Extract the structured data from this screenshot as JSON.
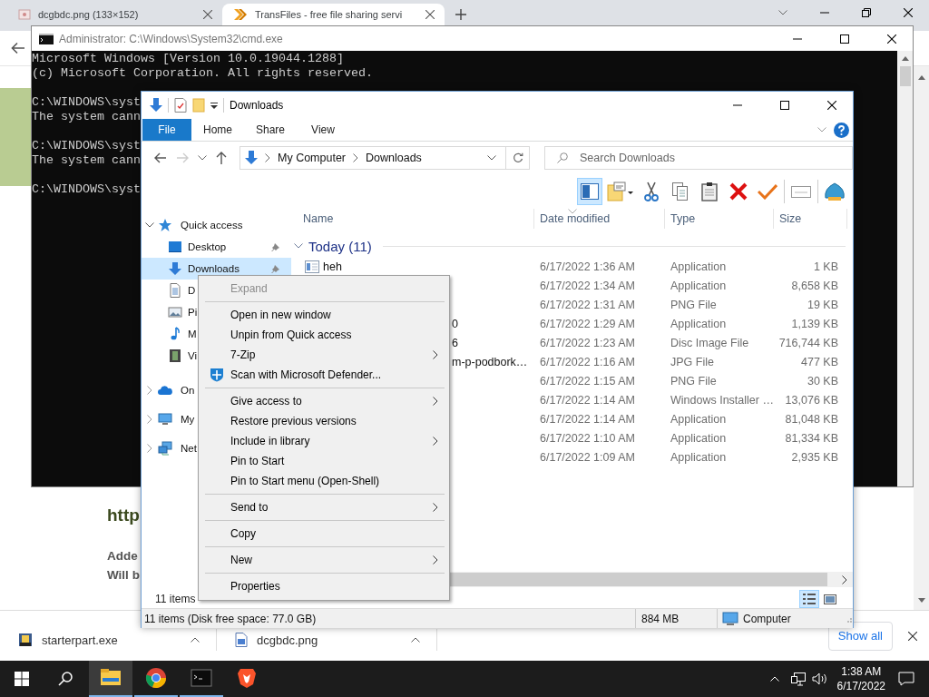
{
  "browser": {
    "tabs": [
      {
        "title": "dcgbdc.png (133×152)",
        "selected": false
      },
      {
        "title": "TransFiles - free file sharing servi",
        "selected": true
      }
    ],
    "page": {
      "heading": "http",
      "lines": [
        "Adde",
        "Will b"
      ]
    }
  },
  "cmd_window": {
    "title": "Administrator: C:\\Windows\\System32\\cmd.exe",
    "blocks": [
      [
        "Microsoft Windows [Version 10.0.19044.1288]",
        "(c) Microsoft Corporation. All rights reserved."
      ],
      [
        "C:\\WINDOWS\\syst",
        "The system cann"
      ],
      [
        "C:\\WINDOWS\\syst",
        "The system cann"
      ],
      [
        "C:\\WINDOWS\\syst"
      ]
    ]
  },
  "explorer": {
    "title": "Downloads",
    "ribbon_tabs": [
      {
        "label": "File",
        "kind": "file"
      },
      {
        "label": "Home",
        "kind": "tab"
      },
      {
        "label": "Share",
        "kind": "tab"
      },
      {
        "label": "View",
        "kind": "tab"
      }
    ],
    "address": {
      "path": [
        "My Computer",
        "Downloads"
      ]
    },
    "search": {
      "placeholder": "Search Downloads"
    },
    "toolbar": [
      {
        "kind": "preview-pane",
        "selected": true
      },
      {
        "kind": "folder-menu",
        "selected": false
      },
      {
        "kind": "cut",
        "selected": false
      },
      {
        "kind": "copy",
        "selected": false
      },
      {
        "kind": "paste",
        "selected": false
      },
      {
        "kind": "delete",
        "selected": false
      },
      {
        "kind": "check",
        "selected": false
      },
      {
        "kind": "rename",
        "selected": false
      },
      {
        "kind": "shell",
        "selected": false
      }
    ],
    "nav": [
      {
        "label": "Quick access",
        "kind": "star",
        "expanded": true,
        "selected": false,
        "children": [
          {
            "label": "Desktop",
            "kind": "desktop",
            "pinned": true,
            "selected": false
          },
          {
            "label": "Downloads",
            "kind": "download",
            "pinned": true,
            "selected": true
          },
          {
            "label": "D",
            "kind": "document",
            "selected": false
          },
          {
            "label": "Pi",
            "kind": "picture",
            "selected": false
          },
          {
            "label": "M",
            "kind": "music",
            "selected": false
          },
          {
            "label": "Vi",
            "kind": "video",
            "selected": false
          }
        ]
      },
      {
        "label": "On",
        "kind": "cloud",
        "expanded": false,
        "selected": false
      },
      {
        "label": "My",
        "kind": "computer",
        "expanded": false,
        "selected": false
      },
      {
        "label": "Net",
        "kind": "network",
        "expanded": false,
        "selected": false
      }
    ],
    "columns": [
      {
        "label": "Name",
        "sorted": false
      },
      {
        "label": "Date modified",
        "sorted": true
      },
      {
        "label": "Type",
        "sorted": false
      },
      {
        "label": "Size",
        "sorted": false
      }
    ],
    "group": {
      "label": "Today (11)",
      "expanded": true
    },
    "rows": [
      {
        "kind": "icon-name",
        "name": "heh",
        "date": "6/17/2022 1:36 AM",
        "type": "Application",
        "size": "1 KB"
      },
      {
        "kind": "covered",
        "date": "6/17/2022 1:34 AM",
        "type": "Application",
        "size": "8,658 KB"
      },
      {
        "kind": "covered",
        "date": "6/17/2022 1:31 AM",
        "type": "PNG File",
        "size": "19 KB"
      },
      {
        "kind": "covered",
        "name": "0",
        "date": "6/17/2022 1:29 AM",
        "type": "Application",
        "size": "1,139 KB"
      },
      {
        "kind": "covered",
        "name": "6",
        "date": "6/17/2022 1:23 AM",
        "type": "Disc Image File",
        "size": "716,744 KB"
      },
      {
        "kind": "covered",
        "name": "m-p-podbork…",
        "date": "6/17/2022 1:16 AM",
        "type": "JPG File",
        "size": "477 KB"
      },
      {
        "kind": "covered",
        "date": "6/17/2022 1:15 AM",
        "type": "PNG File",
        "size": "30 KB"
      },
      {
        "kind": "covered",
        "date": "6/17/2022 1:14 AM",
        "type": "Windows Installer …",
        "size": "13,076 KB"
      },
      {
        "kind": "covered",
        "date": "6/17/2022 1:14 AM",
        "type": "Application",
        "size": "81,048 KB"
      },
      {
        "kind": "covered",
        "date": "6/17/2022 1:10 AM",
        "type": "Application",
        "size": "81,334 KB"
      },
      {
        "kind": "covered",
        "date": "6/17/2022 1:09 AM",
        "type": "Application",
        "size": "2,935 KB"
      }
    ],
    "item_count": "11 items",
    "view_buttons": [
      {
        "kind": "details",
        "selected": true
      },
      {
        "kind": "large-icons",
        "selected": false
      }
    ],
    "status": {
      "items": "11 items (Disk free space: 77.0 GB)",
      "size": "884 MB",
      "location": "Computer"
    }
  },
  "context_menu": {
    "items": [
      {
        "kind": "item",
        "label": "Expand",
        "disabled": true,
        "submenu": false
      },
      {
        "kind": "separator"
      },
      {
        "kind": "item",
        "label": "Open in new window",
        "disabled": false,
        "submenu": false
      },
      {
        "kind": "item",
        "label": "Unpin from Quick access",
        "disabled": false,
        "submenu": false
      },
      {
        "kind": "item",
        "label": "7-Zip",
        "disabled": false,
        "submenu": true
      },
      {
        "kind": "icon-item",
        "label": "Scan with Microsoft Defender...",
        "disabled": false,
        "submenu": false
      },
      {
        "kind": "separator"
      },
      {
        "kind": "item",
        "label": "Give access to",
        "disabled": false,
        "submenu": true
      },
      {
        "kind": "item",
        "label": "Restore previous versions",
        "disabled": false,
        "submenu": false
      },
      {
        "kind": "item",
        "label": "Include in library",
        "disabled": false,
        "submenu": true
      },
      {
        "kind": "item",
        "label": "Pin to Start",
        "disabled": false,
        "submenu": false
      },
      {
        "kind": "item",
        "label": "Pin to Start menu (Open-Shell)",
        "disabled": false,
        "submenu": false
      },
      {
        "kind": "separator"
      },
      {
        "kind": "item",
        "label": "Send to",
        "disabled": false,
        "submenu": true
      },
      {
        "kind": "separator"
      },
      {
        "kind": "item",
        "label": "Copy",
        "disabled": false,
        "submenu": false
      },
      {
        "kind": "separator"
      },
      {
        "kind": "item",
        "label": "New",
        "disabled": false,
        "submenu": true
      },
      {
        "kind": "separator"
      },
      {
        "kind": "item",
        "label": "Properties",
        "disabled": false,
        "submenu": false
      }
    ]
  },
  "downloads_bar": {
    "items": [
      {
        "name": "starterpart.exe",
        "kind": "exe"
      },
      {
        "name": "dcgbdc.png",
        "kind": "image"
      }
    ],
    "show_all": "Show all"
  },
  "taskbar": {
    "apps": [
      {
        "kind": "explorer",
        "running": true,
        "selected": true
      },
      {
        "kind": "chrome",
        "running": true,
        "selected": false
      },
      {
        "kind": "terminal",
        "running": true,
        "selected": false
      },
      {
        "kind": "brave",
        "running": false,
        "selected": false
      }
    ],
    "time": "1:38 AM",
    "date": "6/17/2022"
  }
}
